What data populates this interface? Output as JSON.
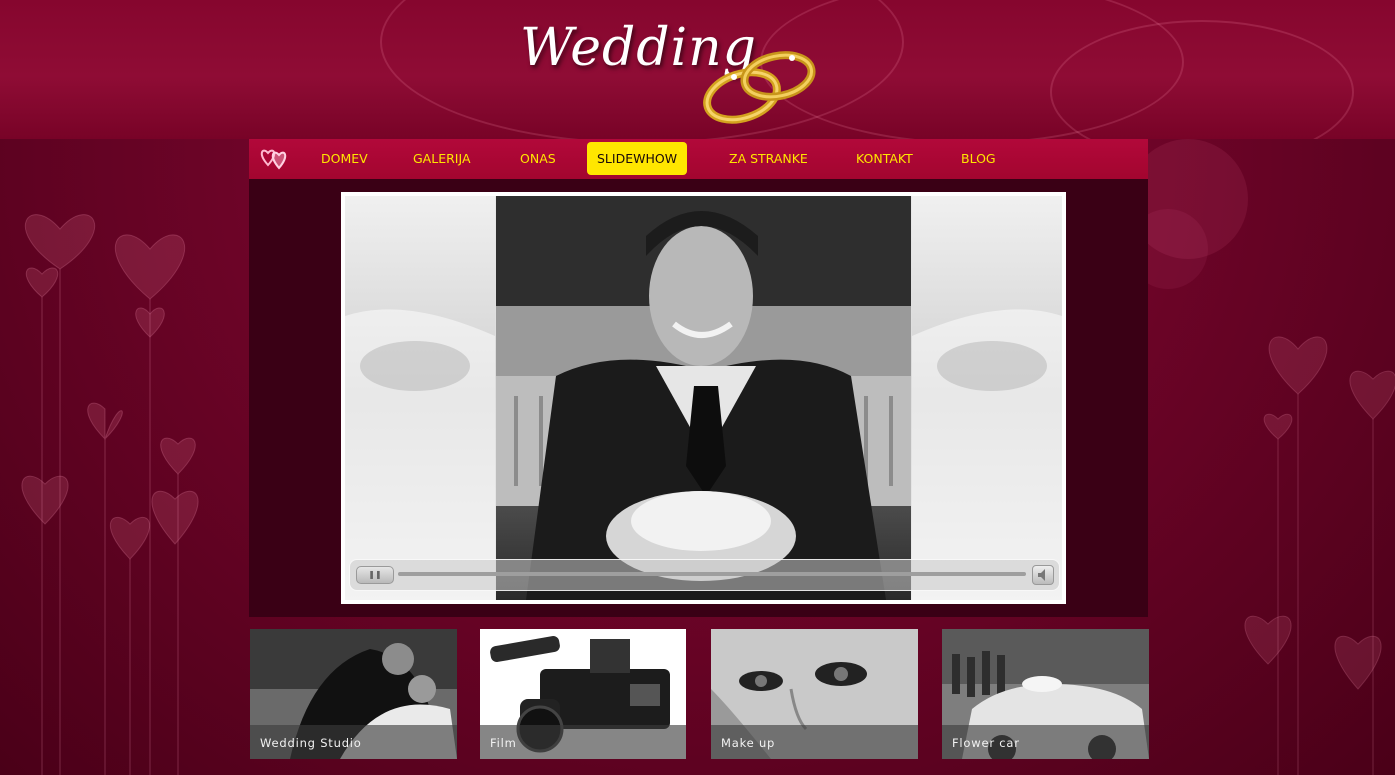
{
  "header": {
    "logo_text": "Wedding",
    "logo_icon": "wedding-rings-icon"
  },
  "nav": {
    "icon": "hearts-icon",
    "items": [
      {
        "label": "DOMEV",
        "active": false
      },
      {
        "label": "GALERIJA",
        "active": false
      },
      {
        "label": "ONAS",
        "active": false
      },
      {
        "label": "SLIDEWHOW",
        "active": true
      },
      {
        "label": "ZA STRANKE",
        "active": false
      },
      {
        "label": "KONTAKT",
        "active": false
      },
      {
        "label": "BLOG",
        "active": false
      }
    ]
  },
  "slideshow": {
    "controls": {
      "play_icon": "play-pause-icon",
      "volume_icon": "volume-icon",
      "progress": 0
    }
  },
  "thumbnails": [
    {
      "caption": "Wedding Studio"
    },
    {
      "caption": "Film"
    },
    {
      "caption": "Make up"
    },
    {
      "caption": "Flower car"
    }
  ],
  "colors": {
    "background": "#6e0428",
    "nav_bg": "#a3052f",
    "nav_text": "#ffe600",
    "active_bg": "#ffe600",
    "panel_bg": "#3a0015"
  }
}
